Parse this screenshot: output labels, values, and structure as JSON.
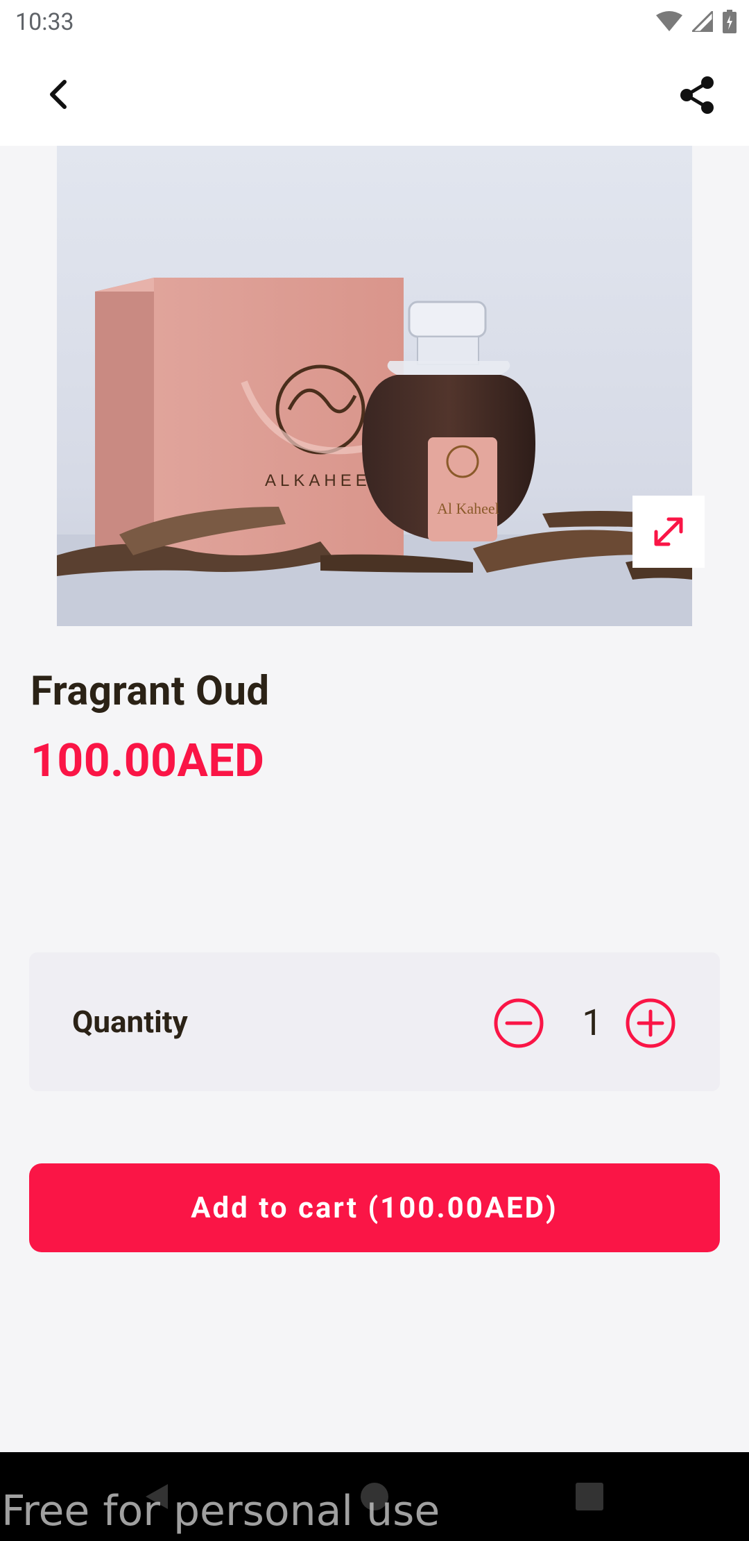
{
  "status_bar": {
    "time": "10:33",
    "icons": [
      "wifi-icon",
      "signal-icon",
      "battery-icon"
    ]
  },
  "app_bar": {
    "back_icon": "chevron-left-icon",
    "share_icon": "share-icon"
  },
  "product": {
    "image_alt": "Fragrant Oud product photo",
    "expand_icon": "expand-icon",
    "title": "Fragrant Oud",
    "price": "100.00AED"
  },
  "quantity": {
    "label": "Quantity",
    "value": "1",
    "minus_icon": "minus-circle-icon",
    "plus_icon": "plus-circle-icon"
  },
  "cart": {
    "button_label": "Add to cart (100.00AED)"
  },
  "watermark": "Free for personal use",
  "colors": {
    "accent": "#fa1546",
    "text": "#2b2216",
    "background": "#f5f5f7",
    "card": "#efeef3"
  }
}
